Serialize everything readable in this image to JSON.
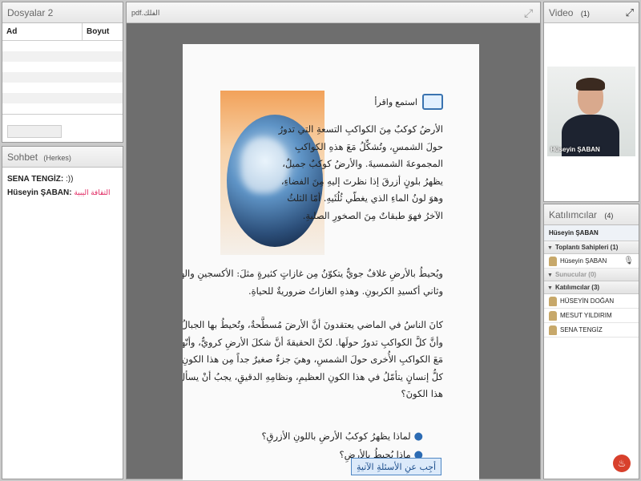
{
  "files": {
    "title": "Dosyalar 2",
    "col_name": "Ad",
    "col_size": "Boyut"
  },
  "chat": {
    "title": "Sohbet",
    "scope": "(Herkes)",
    "messages": [
      {
        "sender": "SENA TENGİZ:",
        "text": ":))"
      },
      {
        "sender": "Hüseyin ŞABAN:",
        "text": "الثقافة اليبية"
      }
    ]
  },
  "viewer": {
    "title": "pdf.الفلك",
    "heading": "استمع واقرأ",
    "para1": [
      "الأرضُ كوكبٌ مِنَ الكواكبِ التسعةِ التي تدورُ",
      "حولَ الشمسِ، وتُشكِّلُ مَعَ هذهِ الكواكبِ",
      "المجموعةَ الشمسيةَ. والأرضُ كوكبٌ جميلٌ،",
      "يظهرُ بلونٍ أزرقَ إذا نظرتَ إليهِ مِنَ الفضاءِ،",
      "وهوَ لونُ الماءِ الذي يغطّي ثُلُثَيهِ. أمّا الثلثُ",
      "الآخرُ فهوَ طبقاتٌ مِنَ الصخورِ الصلبةِ."
    ],
    "para2": [
      "ويُحيطُ بالأرضِ غلافٌ جويٌّ يتكوّنُ مِن غازاتٍ كثيرةٍ مثلَ: الأكسجينِ والهدروجينِ",
      "وثاني أكسيدِ الكربونِ. وهذهِ الغازاتُ ضروريةٌ للحياةِ."
    ],
    "para3": [
      "كانَ الناسُ في الماضي يعتقدونَ أنَّ الأرضَ مُسطَّحةٌ، وتُحيطُ بها الجبالُ والبحارُ،",
      "وأنَّ كلَّ الكواكبِ تدورُ حولَها. لكنَّ الحقيقةَ أنَّ شكلَ الأرضِ كرويٌّ، وأنّها تدورُ",
      "مَعَ الكواكبِ الأُخرى حولَ الشمسِ، وهيَ جزءٌ صغيرٌ جداً مِن هذا الكونِ الواسعِ.",
      "كلُّ إنسانٍ يتأمّلُ في هذا الكونِ العظيمِ، ونظامِهِ الدقيقِ، يجبُ أنْ يسألَ نفسَهُ مَن نظّمَ",
      "هذا الكونَ؟"
    ],
    "questions": [
      "لماذا يظهرُ كوكبُ الأرضِ باللونِ الأزرقِ؟",
      "ماذا يُحيطُ بالأرضِ؟"
    ],
    "answer_btn": "أجِب عنِ الأسئلةِ الآتيةِ"
  },
  "video": {
    "title": "Video",
    "count": "(1)",
    "presenter": "Hüseyin ŞABAN"
  },
  "participants": {
    "title": "Katılımcılar",
    "count": "(4)",
    "me": "Hüseyin ŞABAN",
    "groups": [
      {
        "label": "Toplantı Sahipleri (1)",
        "members": [
          "Hüseyin ŞABAN"
        ]
      },
      {
        "label": "Sunucular (0)",
        "members": []
      },
      {
        "label": "Katılımcılar (3)",
        "members": [
          "HÜSEYİN DOĞAN",
          "MESUT YILDIRIM",
          "SENA TENGİZ"
        ]
      }
    ]
  }
}
